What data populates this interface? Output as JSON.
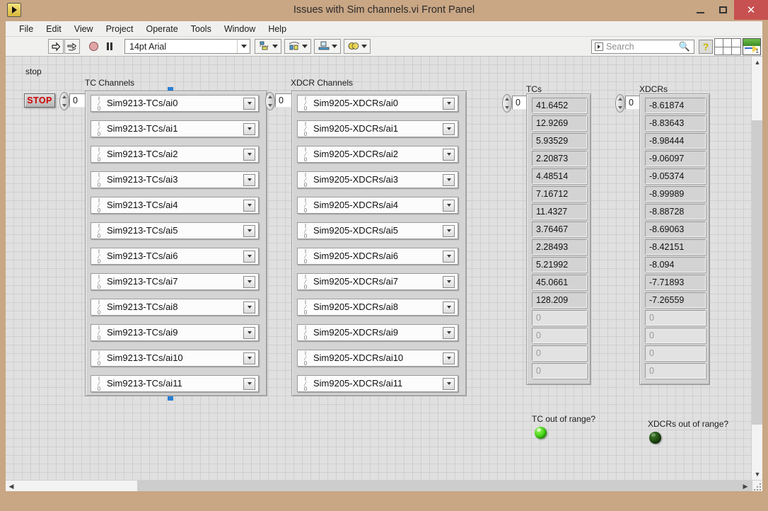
{
  "window": {
    "title": "Issues with Sim channels.vi Front Panel",
    "icon": "labview-vi-icon",
    "buttons": {
      "minimize": "–",
      "maximize": "▢",
      "close": "✕"
    }
  },
  "menubar": {
    "items": [
      "File",
      "Edit",
      "View",
      "Project",
      "Operate",
      "Tools",
      "Window",
      "Help"
    ]
  },
  "toolbar": {
    "run_label": "run-arrow",
    "run_continuous_label": "run-continuously",
    "abort_label": "abort-execution",
    "pause_label": "pause",
    "font_value": "14pt Arial",
    "align_objects": "align-objects",
    "distribute_objects": "distribute-objects",
    "resize_objects": "resize-objects",
    "reorder": "reorder-objects",
    "search_placeholder": "Search",
    "help_label": "?",
    "vi_icon_number": "1"
  },
  "panel": {
    "stop": {
      "label": "stop",
      "button_text": "STOP"
    },
    "tc_index": "0",
    "xdcr_index": "0",
    "tcs_index": "0",
    "xdcrs_index": "0",
    "tc_channels": {
      "label": "TC Channels",
      "values": [
        "Sim9213-TCs/ai0",
        "Sim9213-TCs/ai1",
        "Sim9213-TCs/ai2",
        "Sim9213-TCs/ai3",
        "Sim9213-TCs/ai4",
        "Sim9213-TCs/ai5",
        "Sim9213-TCs/ai6",
        "Sim9213-TCs/ai7",
        "Sim9213-TCs/ai8",
        "Sim9213-TCs/ai9",
        "Sim9213-TCs/ai10",
        "Sim9213-TCs/ai11"
      ]
    },
    "xdcr_channels": {
      "label": "XDCR Channels",
      "values": [
        "Sim9205-XDCRs/ai0",
        "Sim9205-XDCRs/ai1",
        "Sim9205-XDCRs/ai2",
        "Sim9205-XDCRs/ai3",
        "Sim9205-XDCRs/ai4",
        "Sim9205-XDCRs/ai5",
        "Sim9205-XDCRs/ai6",
        "Sim9205-XDCRs/ai7",
        "Sim9205-XDCRs/ai8",
        "Sim9205-XDCRs/ai9",
        "Sim9205-XDCRs/ai10",
        "Sim9205-XDCRs/ai11"
      ]
    },
    "tcs": {
      "label": "TCs",
      "values": [
        "41.6452",
        "12.9269",
        "5.93529",
        "2.20873",
        "4.48514",
        "7.16712",
        "11.4327",
        "3.76467",
        "2.28493",
        "5.21992",
        "45.0661",
        "128.209",
        "0",
        "0",
        "0",
        "0"
      ],
      "filled_count": 12
    },
    "xdcrs": {
      "label": "XDCRs",
      "values": [
        "-8.61874",
        "-8.83643",
        "-8.98444",
        "-9.06097",
        "-9.05374",
        "-8.99989",
        "-8.88728",
        "-8.69063",
        "-8.42151",
        "-8.094",
        "-7.71893",
        "-7.26559",
        "0",
        "0",
        "0",
        "0"
      ],
      "filled_count": 12
    },
    "leds": [
      {
        "label": "TC out of range?",
        "state": "on",
        "color": "#3fd612"
      },
      {
        "label": "XDCRs out of range?",
        "state": "off",
        "color": "#1e4a10"
      }
    ]
  },
  "colors": {
    "title_bar": "#c9a684",
    "close_button": "#c75050",
    "canvas": "#e0e0e0",
    "grid_line": "#cfcfcf",
    "stop_text": "#d00000",
    "selection_handle": "#2a7fd4"
  }
}
